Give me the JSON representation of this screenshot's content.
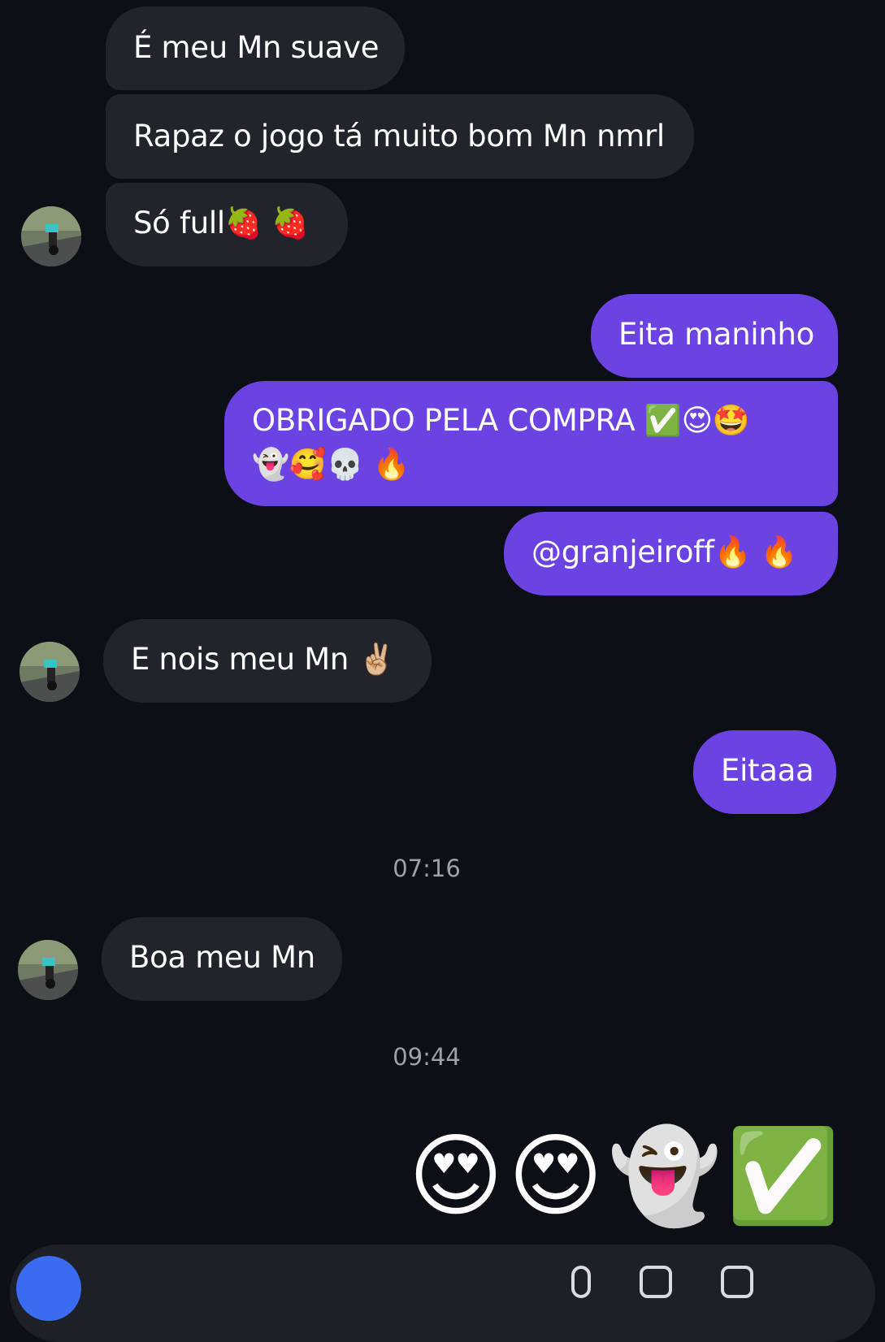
{
  "conversation": {
    "messages": [
      {
        "side": "incoming",
        "text": "É meu Mn suave"
      },
      {
        "side": "incoming",
        "text": "Rapaz o jogo tá muito bom Mn nmrl"
      },
      {
        "side": "incoming",
        "text": "Só full🍓 🍓"
      },
      {
        "side": "outgoing",
        "text": "Eita maninho"
      },
      {
        "side": "outgoing",
        "line1": "OBRIGADO PELA COMPRA ✅😍🤩",
        "line2": "👻🥰💀 🔥"
      },
      {
        "side": "outgoing",
        "text": "@granjeiroff🔥 🔥"
      },
      {
        "side": "incoming",
        "text": "E nois meu Mn ✌🏼"
      },
      {
        "side": "outgoing",
        "text": "Eitaaa"
      },
      {
        "side": "incoming",
        "text": "Boa meu Mn"
      }
    ],
    "timestamps": [
      "07:16",
      "09:44"
    ],
    "emoji_reply": "😍😍👻✅"
  },
  "icons": {
    "avatar": "profile-photo-avatar",
    "composer_left": "camera-icon",
    "composer_right": [
      "mic-icon",
      "image-icon",
      "sticker-icon"
    ]
  },
  "colors": {
    "background": "#0d0f16",
    "incoming_bubble": "#22242b",
    "outgoing_bubble": "#6c43e3",
    "timestamp_text": "#9ea1aa"
  }
}
